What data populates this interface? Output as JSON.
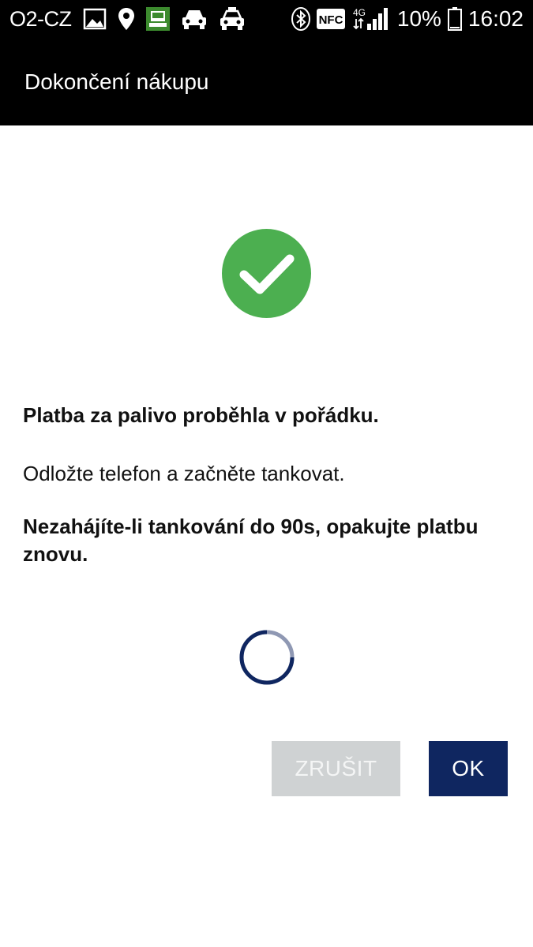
{
  "status_bar": {
    "carrier": "O2-CZ",
    "network_label": "4G",
    "nfc_label": "NFC",
    "battery_percent": "10%",
    "time": "16:02",
    "icons": [
      "image-icon",
      "location-pin-icon",
      "app-notification-icon",
      "car-icon",
      "taxi-icon",
      "bluetooth-icon",
      "nfc-icon",
      "signal-icon",
      "battery-icon"
    ]
  },
  "app_bar": {
    "title": "Dokončení nákupu"
  },
  "dialog": {
    "icon": "check-circle-icon",
    "icon_color": "#4caf50",
    "message_primary": "Platba za palivo proběhla v pořádku.",
    "message_secondary": "Odložte telefon a začněte tankovat.",
    "message_warning": "Nezahájíte-li tankování do 90s, opakujte platbu znovu.",
    "spinner_color": "#0f2660"
  },
  "buttons": {
    "cancel_label": "ZRUŠIT",
    "ok_label": "OK"
  }
}
